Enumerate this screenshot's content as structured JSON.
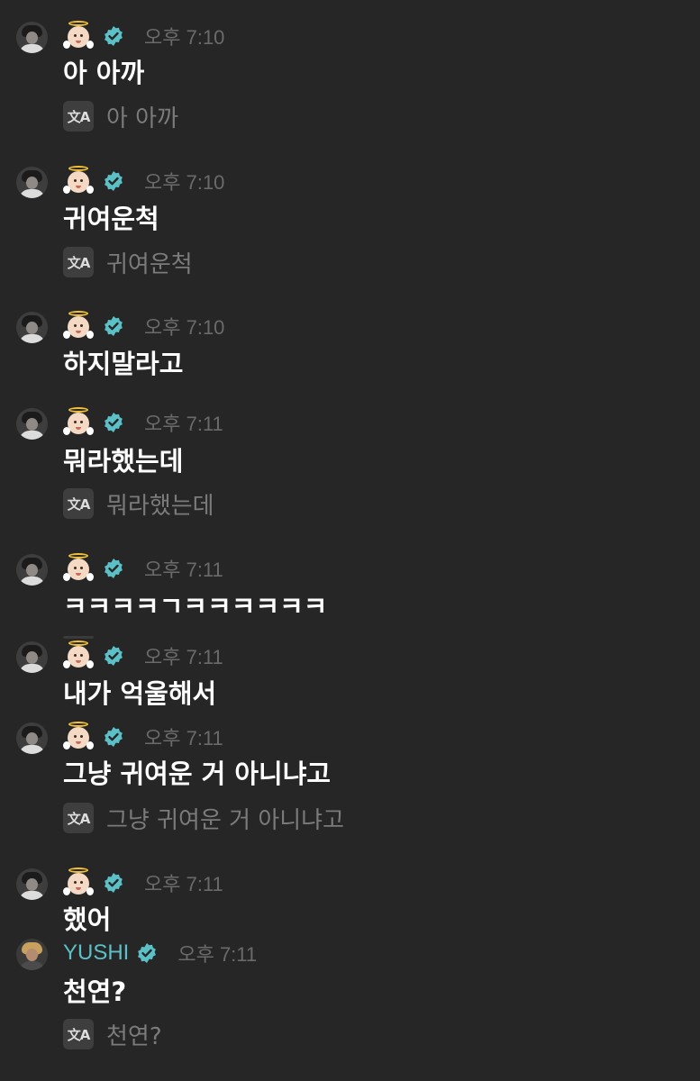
{
  "time_prefix": "오후",
  "colors": {
    "background": "#262626",
    "message_text": "#ffffff",
    "timestamp": "#6a6a6a",
    "translation_text": "#7b7b7b",
    "verified_badge": "#5cc0c7",
    "username": "#5cc0c7"
  },
  "messages": [
    {
      "avatar": "member-avatar",
      "badge": "angel-emoji",
      "time": "오후 7:10",
      "text": "아 아까",
      "translation": "아 아까"
    },
    {
      "avatar": "member-avatar",
      "badge": "angel-emoji",
      "time": "오후 7:10",
      "text": "귀여운척",
      "translation": "귀여운척"
    },
    {
      "avatar": "member-avatar",
      "badge": "angel-emoji",
      "time": "오후 7:10",
      "text": "하지말라고"
    },
    {
      "avatar": "member-avatar",
      "badge": "angel-emoji",
      "time": "오후 7:11",
      "text": "뭐라했는데",
      "translation": "뭐라했는데"
    },
    {
      "avatar": "member-avatar",
      "badge": "angel-emoji",
      "time": "오후 7:11",
      "text": "ㅋㅋㅋㅋㄱㅋㅋㅋㅋㅋㅋ"
    },
    {
      "avatar": "member-avatar",
      "badge": "angel-emoji",
      "time": "오후 7:11",
      "text": "내가 억울해서"
    },
    {
      "avatar": "member-avatar",
      "badge": "angel-emoji",
      "time": "오후 7:11",
      "text": "그냥 귀여운 거 아니냐고",
      "translation": "그냥 귀여운 거 아니냐고"
    },
    {
      "avatar": "member-avatar",
      "badge": "angel-emoji",
      "time": "오후 7:11",
      "text": "했어"
    },
    {
      "avatar": "yushi-avatar",
      "name": "YUSHI",
      "time": "오후 7:11",
      "text": "천연?",
      "translation": "천연?"
    }
  ],
  "translate_icon_label": "文A"
}
